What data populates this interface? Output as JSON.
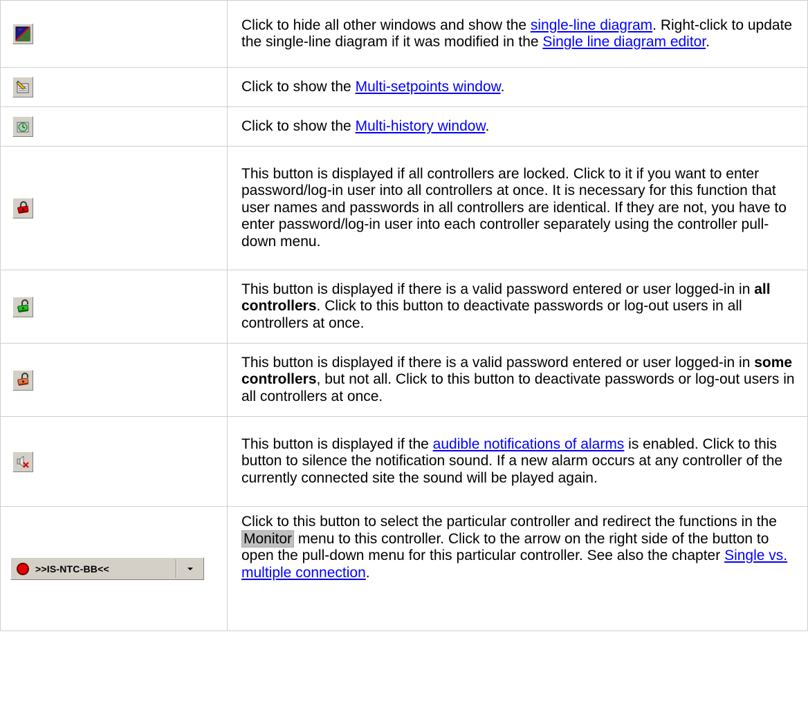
{
  "rows": [
    {
      "icon": "single-line-diagram-icon",
      "t1": "Click to hide all other windows and show the ",
      "link1": "single-line diagram",
      "t2": ". Right-click to update the single-line diagram if it was modified in the ",
      "link2": "Single line diagram editor",
      "t3": "."
    },
    {
      "icon": "multi-setpoints-icon",
      "t1": "Click to show the ",
      "link1": "Multi-setpoints window",
      "t2": "."
    },
    {
      "icon": "multi-history-icon",
      "t1": "Click to show the ",
      "link1": "Multi-history window",
      "t2": "."
    },
    {
      "icon": "locked-red-icon",
      "t1": "This button is displayed if all controllers are locked. Click to it if you want to enter password/log-in user into all controllers at once. It is necessary for this function that user names and passwords in all controllers are identical. If they are not, you have to enter password/log-in user into each controller separately using the controller pull-down menu."
    },
    {
      "icon": "unlocked-green-icon",
      "t1": "This button is displayed if there is a valid password entered or user logged-in in ",
      "b1": "all controllers",
      "t2": ". Click to this button to deactivate passwords or log-out users in all controllers at once."
    },
    {
      "icon": "unlocked-partial-icon",
      "t1": "This button is displayed if there is a valid password entered or user logged-in in ",
      "b1": "some controllers",
      "t2": ", but not all. Click to this button to deactivate passwords or log-out users in all controllers at once."
    },
    {
      "icon": "mute-alarm-icon",
      "t1": "This button is displayed if the ",
      "link1": "audible notifications of alarms",
      "t2": " is enabled. Click to this button to silence the notification sound. If a new alarm occurs at any controller of the currently connected site the sound will be played again."
    },
    {
      "icon": "controller-button",
      "button_label": ">>IS-NTC-BB<<",
      "t1": "Click to this button to select the particular controller and redirect the functions in the ",
      "menu": "Monitor",
      "t2": " menu to this controller. Click to the arrow on the right side of the button to open the pull-down menu for this particular controller. See also the chapter ",
      "link1": "Single vs. multiple connection",
      "t3": "."
    }
  ]
}
